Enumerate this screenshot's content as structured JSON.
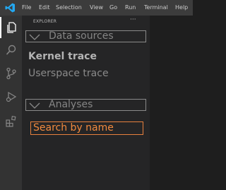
{
  "titlebar": {
    "menu": [
      "File",
      "Edit",
      "Selection",
      "View",
      "Go",
      "Run",
      "Terminal",
      "Help"
    ]
  },
  "activity_bar": {
    "items": [
      "explorer-icon",
      "search-icon",
      "source-control-icon",
      "run-debug-icon",
      "extensions-icon"
    ],
    "active": "explorer-icon"
  },
  "sidebar": {
    "title": "EXPLORER",
    "more": "···",
    "sections": [
      {
        "label": "Data sources",
        "items": [
          "Kernel trace",
          "Userspace trace"
        ]
      },
      {
        "label": "Analyses"
      }
    ],
    "search": {
      "text": "Search by name"
    }
  },
  "colors": {
    "accent": "#e8813d",
    "titlebar": "#3c3c3c",
    "activitybar": "#333333",
    "sidebar": "#252526",
    "editor": "#1e1e1e"
  }
}
